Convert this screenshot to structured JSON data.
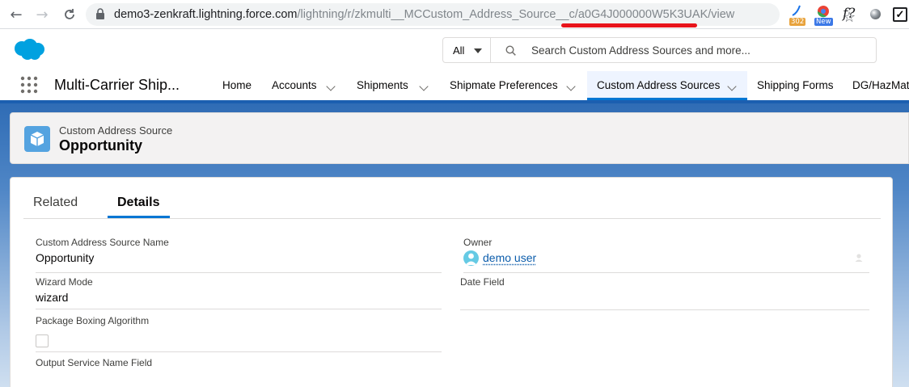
{
  "browser": {
    "url_host": "demo3-zenkraft.lightning.force.com",
    "url_path": "/lightning/r/zkmulti__MCCustom_Address_Source__c/a0G4J000000W5K3UAK/view",
    "ext_302_badge": "302",
    "ext_new_badge": "New",
    "ext_f_label": "f?",
    "ext_check_label": "✓"
  },
  "header": {
    "search_scope": "All",
    "search_placeholder": "Search Custom Address Sources and more..."
  },
  "nav": {
    "app_name": "Multi-Carrier Ship...",
    "items": [
      {
        "label": "Home"
      },
      {
        "label": "Accounts"
      },
      {
        "label": "Shipments"
      },
      {
        "label": "Shipmate Preferences"
      },
      {
        "label": "Custom Address Sources"
      },
      {
        "label": "Shipping Forms"
      },
      {
        "label": "DG/HazMat"
      }
    ]
  },
  "record": {
    "object_type": "Custom Address Source",
    "title": "Opportunity"
  },
  "tabs": [
    {
      "label": "Related"
    },
    {
      "label": "Details"
    }
  ],
  "fields": {
    "name_label": "Custom Address Source Name",
    "name_value": "Opportunity",
    "owner_label": "Owner",
    "owner_value": "demo user",
    "wizard_label": "Wizard Mode",
    "wizard_value": "wizard",
    "date_label": "Date Field",
    "date_value": "",
    "boxing_label": "Package Boxing Algorithm",
    "boxing_checked": false,
    "output_label": "Output Service Name Field"
  },
  "colors": {
    "brand_blue": "#0176d3",
    "link": "#0b5cab",
    "redline": "#e8141b"
  }
}
